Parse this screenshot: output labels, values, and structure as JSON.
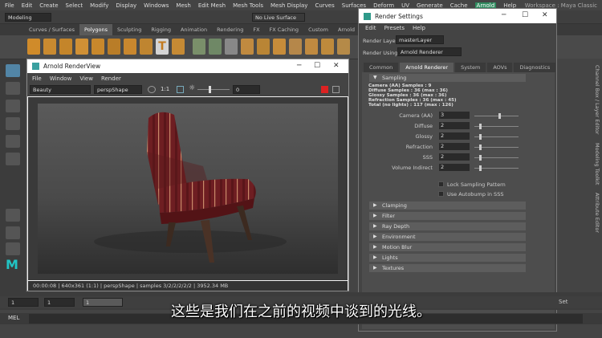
{
  "menubar": {
    "items": [
      "File",
      "Edit",
      "Create",
      "Select",
      "Modify",
      "Display",
      "Windows",
      "Mesh",
      "Edit Mesh",
      "Mesh Tools",
      "Mesh Display",
      "Curves",
      "Surfaces",
      "Deform",
      "UV",
      "Generate",
      "Cache",
      "Arnold",
      "Help"
    ],
    "workspace_label": "Workspace :",
    "workspace_value": "Maya Classic"
  },
  "status": {
    "mode": "Modeling",
    "live_surface": "No Live Surface",
    "user": "8"
  },
  "shelf": {
    "tabs": [
      "Curves / Surfaces",
      "Polygons",
      "Sculpting",
      "Rigging",
      "Animation",
      "Rendering",
      "FX",
      "FX Caching",
      "Custom",
      "Arnold"
    ],
    "active": "Polygons"
  },
  "arnold_view": {
    "title": "Arnold RenderView",
    "menu": [
      "File",
      "Window",
      "View",
      "Render"
    ],
    "aov": "Beauty",
    "camera": "perspShape",
    "ratio": "1:1",
    "exposure": "0",
    "status_text": "00:00:08 | 640x361 (1:1) | perspShape | samples 3/2/2/2/2/2 | 3952.34 MB"
  },
  "render_settings": {
    "title": "Render Settings",
    "menu": [
      "Edit",
      "Presets",
      "Help"
    ],
    "render_layer_label": "Render Layer",
    "render_layer_value": "masterLayer",
    "render_using_label": "Render Using",
    "render_using_value": "Arnold Renderer",
    "tabs": [
      "Common",
      "Arnold Renderer",
      "System",
      "AOVs",
      "Diagnostics"
    ],
    "active_tab": "Arnold Renderer",
    "sampling_title": "Sampling",
    "sampling_info": [
      "Camera (AA) Samples : 9",
      "Diffuse Samples : 36 (max : 36)",
      "Glossy Samples : 36 (max : 36)",
      "Refraction Samples : 36 (max : 45)",
      "Total (no lights) : 117 (max : 126)"
    ],
    "fields": [
      {
        "label": "Camera (AA)",
        "value": "3",
        "level": 0.55
      },
      {
        "label": "Diffuse",
        "value": "2",
        "level": 0.1
      },
      {
        "label": "Glossy",
        "value": "2",
        "level": 0.1
      },
      {
        "label": "Refraction",
        "value": "2",
        "level": 0.1
      },
      {
        "label": "SSS",
        "value": "2",
        "level": 0.1
      },
      {
        "label": "Volume Indirect",
        "value": "2",
        "level": 0.1
      }
    ],
    "checks": [
      "Lock Sampling Pattern",
      "Use Autobump in SSS"
    ],
    "sections": [
      "Clamping",
      "Filter",
      "Ray Depth",
      "Environment",
      "Motion Blur",
      "Lights",
      "Textures"
    ]
  },
  "timeline": {
    "start": "1",
    "current": "1",
    "frame": "1",
    "label_set": "Set"
  },
  "mel": {
    "label": "MEL"
  },
  "right_tabs": [
    "Channel Box / Layer Editor",
    "Modeling Toolkit",
    "Attribute Editor"
  ],
  "subtitle": "这些是我们在之前的视频中谈到的光线。",
  "colors": {
    "accent_green": "#2f8a5e",
    "accent_blue": "#5285a6",
    "chair": "#6e1e22"
  }
}
